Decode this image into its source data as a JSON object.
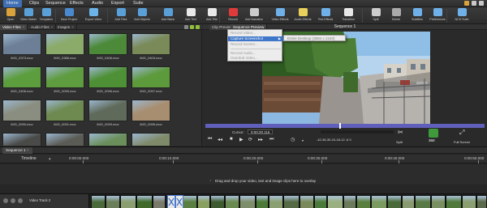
{
  "menubar": {
    "items": [
      "Home",
      "Clips",
      "Sequence",
      "Effects",
      "Audio",
      "Export",
      "Suite"
    ],
    "active": "Home"
  },
  "toolbar": {
    "buttons": [
      {
        "label": "Open",
        "icon": "folder-icon",
        "color": "#d9a23a"
      },
      {
        "label": "Video Maker",
        "icon": "video-maker-icon",
        "color": "#5aa0d8"
      },
      {
        "label": "Templates",
        "icon": "templates-icon",
        "color": "#5aa0d8"
      },
      {
        "label": "Save Project",
        "icon": "save-icon",
        "color": "#4a88d0"
      },
      {
        "label": "Export Video",
        "icon": "export-icon",
        "color": "#6cb3e8"
      },
      {
        "label": "Add Files",
        "icon": "add-files-icon",
        "color": "#5aa0d8"
      },
      {
        "label": "Add Objects",
        "icon": "add-objects-icon",
        "color": "#5aa0d8"
      },
      {
        "label": "Add Blank",
        "icon": "add-blank-icon",
        "color": "#5aa0d8"
      },
      {
        "label": "Add Text",
        "icon": "text-icon",
        "color": "#e8e8e8"
      },
      {
        "label": "Add Title",
        "icon": "title-icon",
        "color": "#e8e8e8"
      },
      {
        "label": "Record",
        "icon": "record-icon",
        "color": "#e03a3a"
      },
      {
        "label": "Add Narration",
        "icon": "narration-icon",
        "color": "#cccccc"
      },
      {
        "label": "Video Effects",
        "icon": "video-effects-icon",
        "color": "#6fb0e8"
      },
      {
        "label": "Audio Effects",
        "icon": "audio-effects-icon",
        "color": "#e8d05a"
      },
      {
        "label": "Text Effects",
        "icon": "text-effects-icon",
        "color": "#6fb0e8"
      },
      {
        "label": "Transition",
        "icon": "transition-icon",
        "color": "#e8e8e8"
      },
      {
        "label": "Split",
        "icon": "split-icon",
        "color": "#cccccc"
      },
      {
        "label": "Delete",
        "icon": "delete-icon",
        "color": "#aaaaaa"
      },
      {
        "label": "Subtitles",
        "icon": "subtitles-icon",
        "color": "#6fb0e8"
      },
      {
        "label": "Preferences",
        "icon": "preferences-icon",
        "color": "#6fb0e8"
      },
      {
        "label": "NCH Suite",
        "icon": "nch-suite-icon",
        "color": "#6fb0e8"
      }
    ]
  },
  "left_panel": {
    "tabs": [
      {
        "label": "Video Files",
        "active": true
      },
      {
        "label": "Audio Files",
        "active": false
      },
      {
        "label": "Images",
        "active": false
      }
    ],
    "files": [
      {
        "name": "IMG_0373.mov",
        "tint": "#6c7f96"
      },
      {
        "name": "IMG_0386.mov",
        "tint": "#8bab6a"
      },
      {
        "name": "IMG_0406.mov",
        "tint": "#4c8a3a"
      },
      {
        "name": "IMG_0403.mov",
        "tint": "#7a8a58"
      },
      {
        "name": "IMG_0408.mov",
        "tint": "#5c9e3e"
      },
      {
        "name": "IMG_0095.mov",
        "tint": "#5f9c40"
      },
      {
        "name": "IMG_0096.mov",
        "tint": "#4e9035"
      },
      {
        "name": "IMG_0097.mov",
        "tint": "#5d9a3c"
      },
      {
        "name": "IMG_0090.mov",
        "tint": "#8a8e80"
      },
      {
        "name": "IMG_0091.mov",
        "tint": "#6e8a50"
      },
      {
        "name": "IMG_0099.mov",
        "tint": "#5f6a5a"
      },
      {
        "name": "IMG_0096.mov",
        "tint": "#a88e70"
      },
      {
        "name": "IMG_0092.mov",
        "tint": "#4a4a48"
      },
      {
        "name": "IMG_0093.mov",
        "tint": "#5b5b55"
      },
      {
        "name": "IMG_0094.mov",
        "tint": "#6a8f5a"
      },
      {
        "name": "IMG_0098.mov",
        "tint": "#7f8a6a"
      }
    ]
  },
  "preview": {
    "tabs": [
      {
        "label": "Clip Preview",
        "active": false
      },
      {
        "label": "Sequence Preview",
        "active": true
      }
    ],
    "title": "Sequence 1",
    "cursor_label": "Cursor:",
    "cursor_value": "0:00:20.116",
    "level_meter": "-42-36-30-24-18-12  -6   0",
    "split_label": "Split",
    "fps": "360",
    "fullscreen_label": "Full Screen"
  },
  "dropdown": {
    "items": [
      {
        "label": "Record Video...",
        "state": "disabled"
      },
      {
        "label": "Capture Screenshot",
        "state": "selected",
        "submenu": true
      },
      {
        "label": "Record Screen...",
        "state": "disabled"
      },
      {
        "label": "Record Audio...",
        "state": "disabled"
      },
      {
        "label": "Overdub Video...",
        "state": "disabled"
      }
    ],
    "submenu_item": "Entire Desktop (3584 x 2240)"
  },
  "timeline": {
    "sequence_tab": "Sequence 1",
    "ruler_label": "Timeline",
    "ticks": [
      "0:00:00.000",
      "0:00:10.000",
      "0:00:20.000",
      "0:00:30.000",
      "0:00:40.000",
      "0:00:50.000",
      "0:01:00.000",
      "0:01:10.000"
    ],
    "drop_hint": "Drag and drop your video, text and image clips here to overlay",
    "track_name": "Video Track 2"
  }
}
